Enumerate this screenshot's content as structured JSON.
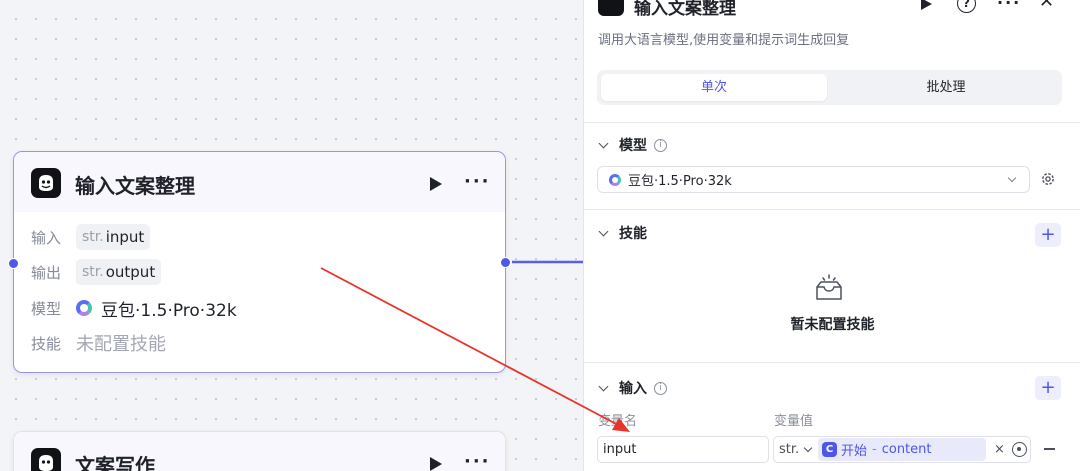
{
  "canvas": {
    "node_main": {
      "title": "输入文案整理",
      "rows": {
        "input_label": "输入",
        "input_type": "str.",
        "input_name": "input",
        "output_label": "输出",
        "output_type": "str.",
        "output_name": "output",
        "model_label": "模型",
        "model_value": "豆包·1.5·Pro·32k",
        "skill_label": "技能",
        "skill_value": "未配置技能"
      }
    },
    "node_second": {
      "title": "文案写作"
    }
  },
  "panel": {
    "title": "输入文案整理",
    "help_glyph": "?",
    "more_glyph": "···",
    "close_glyph": "✕",
    "description": "调用大语言模型,使用变量和提示词生成回复",
    "tabs": [
      {
        "label": "单次",
        "active": true
      },
      {
        "label": "批处理",
        "active": false
      }
    ],
    "model_section": {
      "title": "模型",
      "info_glyph": "i",
      "selected_model": "豆包·1.5·Pro·32k"
    },
    "skill_section": {
      "title": "技能",
      "add_glyph": "+",
      "empty_text": "暂未配置技能"
    },
    "input_section": {
      "title": "输入",
      "info_glyph": "i",
      "add_glyph": "+",
      "col_name": "变量名",
      "col_value": "变量值",
      "rows": [
        {
          "name": "input",
          "type": "str.",
          "ref_icon": "C",
          "ref_source": "开始",
          "ref_sep": "-",
          "ref_field": "content",
          "clear_glyph": "×"
        }
      ]
    }
  },
  "colors": {
    "accent": "#4f56e8",
    "node_border_selected": "#9a93ee",
    "annotation_arrow": "#e8332a"
  }
}
